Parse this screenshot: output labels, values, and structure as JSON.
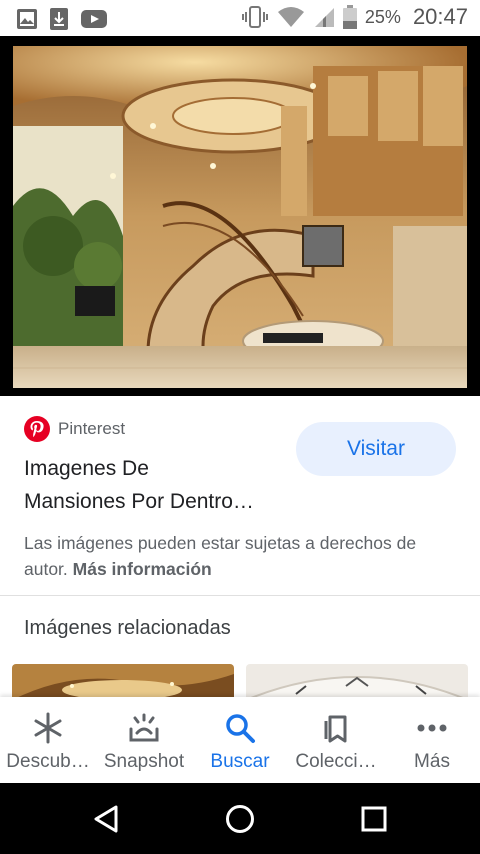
{
  "status_bar": {
    "left_icons": [
      "image-icon",
      "download-icon",
      "youtube-icon"
    ],
    "right_icons": [
      "vibrate-icon",
      "wifi-icon",
      "signal-icon",
      "battery-icon"
    ],
    "battery": "25%",
    "time": "20:47"
  },
  "viewer": {
    "image_description_icon": "mansion-interior-photo"
  },
  "result": {
    "source_icon": "pinterest-icon",
    "source": "Pinterest",
    "title_line1": "Imagenes De",
    "title_line2": "Mansiones Por Dentro…",
    "visit_label": "Visitar",
    "copyright_text": "Las imágenes pueden estar sujetas a derechos de autor. ",
    "more_info": "Más información"
  },
  "related": {
    "heading": "Imágenes relacionadas"
  },
  "bottom_nav": {
    "items": [
      {
        "label": "Descub…",
        "icon": "asterisk-icon"
      },
      {
        "label": "Snapshot",
        "icon": "snapshot-icon"
      },
      {
        "label": "Buscar",
        "icon": "search-icon"
      },
      {
        "label": "Colecci…",
        "icon": "collections-icon"
      },
      {
        "label": "Más",
        "icon": "more-icon"
      }
    ],
    "active_index": 2
  },
  "system_nav": {
    "buttons": [
      "back-icon",
      "home-icon",
      "recents-icon"
    ]
  },
  "colors": {
    "accent": "#1a73e8",
    "visit_bg": "#e8f0fe",
    "pinterest": "#e60023"
  }
}
